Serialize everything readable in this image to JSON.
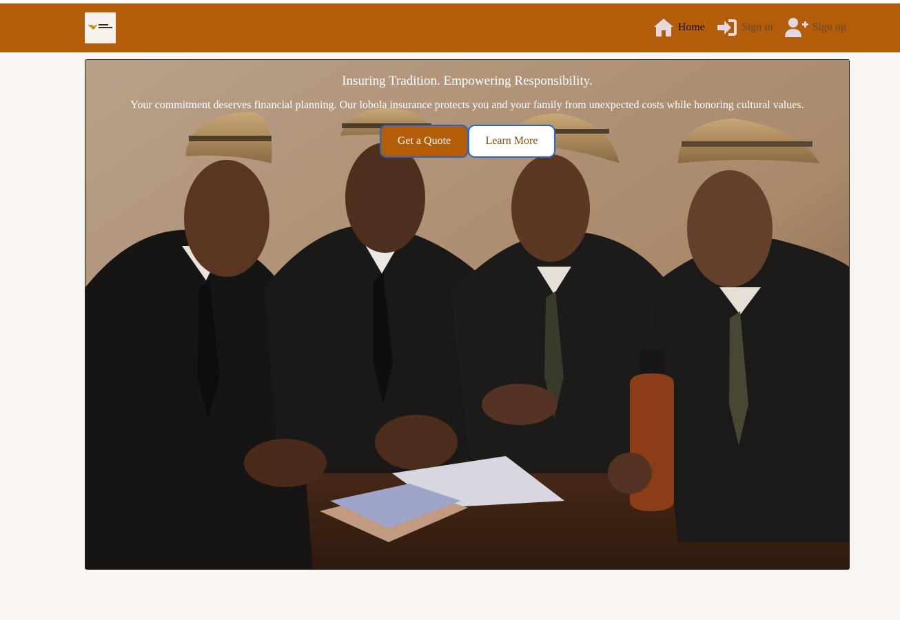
{
  "brand": {
    "logo_text": "lobola insurance",
    "logo_icon": "ox-horns-icon"
  },
  "nav": {
    "home": {
      "label": "Home",
      "icon": "home-icon"
    },
    "signin": {
      "label": "Sign in",
      "icon": "sign-in-icon"
    },
    "signup": {
      "label": "Sign up",
      "icon": "user-plus-icon"
    }
  },
  "hero": {
    "title": "Insuring Tradition. Empowering Responsibility.",
    "subtitle": "Your commitment deserves financial planning. Our lobola insurance protects you and your family from unexpected costs while honoring cultural values.",
    "primary_button": "Get a Quote",
    "secondary_button": "Learn More"
  },
  "colors": {
    "brand": "#b35c0a",
    "page_bg": "#f9f6f2",
    "button_border": "#2a64c6"
  }
}
